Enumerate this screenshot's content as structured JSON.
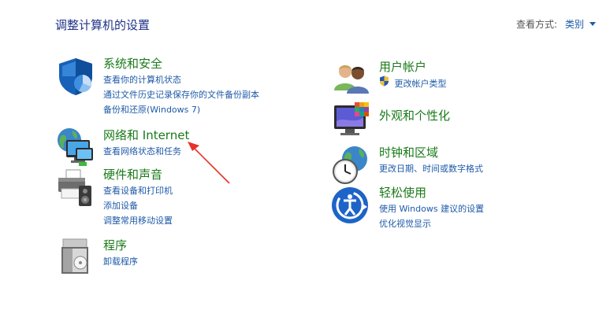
{
  "header": {
    "title": "调整计算机的设置",
    "view_by_label": "查看方式:",
    "view_by_value": "类别"
  },
  "categories": [
    {
      "title": "系统和安全",
      "links": [
        "查看你的计算机状态",
        "通过文件历史记录保存你的文件备份副本",
        "备份和还原(Windows 7)"
      ]
    },
    {
      "title": "网络和 Internet",
      "links": [
        "查看网络状态和任务"
      ]
    },
    {
      "title": "硬件和声音",
      "links": [
        "查看设备和打印机",
        "添加设备",
        "调整常用移动设置"
      ]
    },
    {
      "title": "程序",
      "links": [
        "卸载程序"
      ]
    },
    {
      "title": "用户帐户",
      "links": [
        "更改帐户类型"
      ]
    },
    {
      "title": "外观和个性化",
      "links": []
    },
    {
      "title": "时钟和区域",
      "links": [
        "更改日期、时间或数字格式"
      ]
    },
    {
      "title": "轻松使用",
      "links": [
        "使用 Windows 建议的设置",
        "优化视觉显示"
      ]
    }
  ],
  "colors": {
    "title_blue": "#1e3287",
    "category_green": "#1a7a1a",
    "link_blue": "#1e5aa8",
    "annotation_red": "#e8312a"
  }
}
